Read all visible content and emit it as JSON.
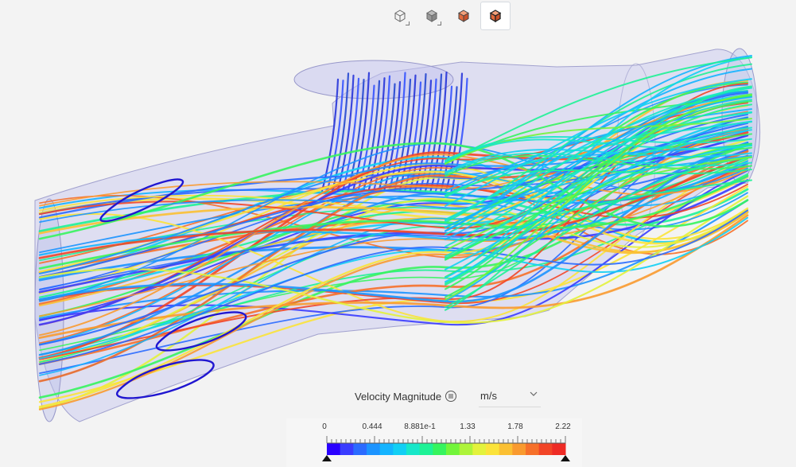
{
  "toolbar": {
    "buttons": [
      {
        "icon": "wireframe-cube-icon",
        "active": false
      },
      {
        "icon": "solid-cube-icon",
        "active": false
      },
      {
        "icon": "shaded-orange-cube-icon",
        "active": false
      },
      {
        "icon": "shaded-orange-edges-cube-icon",
        "active": true
      }
    ]
  },
  "legend": {
    "title": "Velocity Magnitude",
    "unit": "m/s",
    "tick_labels": [
      "0",
      "0.444",
      "8.881e-1",
      "1.33",
      "1.78",
      "2.22"
    ],
    "colors": [
      "#2a00ff",
      "#3a3cff",
      "#2b6bff",
      "#1c94ff",
      "#14b4ff",
      "#12cff4",
      "#17e7c9",
      "#1ef296",
      "#36f45e",
      "#72f53a",
      "#aef43a",
      "#e3f23c",
      "#fbe33a",
      "#fbc033",
      "#f99a2f",
      "#f6702a",
      "#f24527",
      "#ee2b25"
    ]
  }
}
